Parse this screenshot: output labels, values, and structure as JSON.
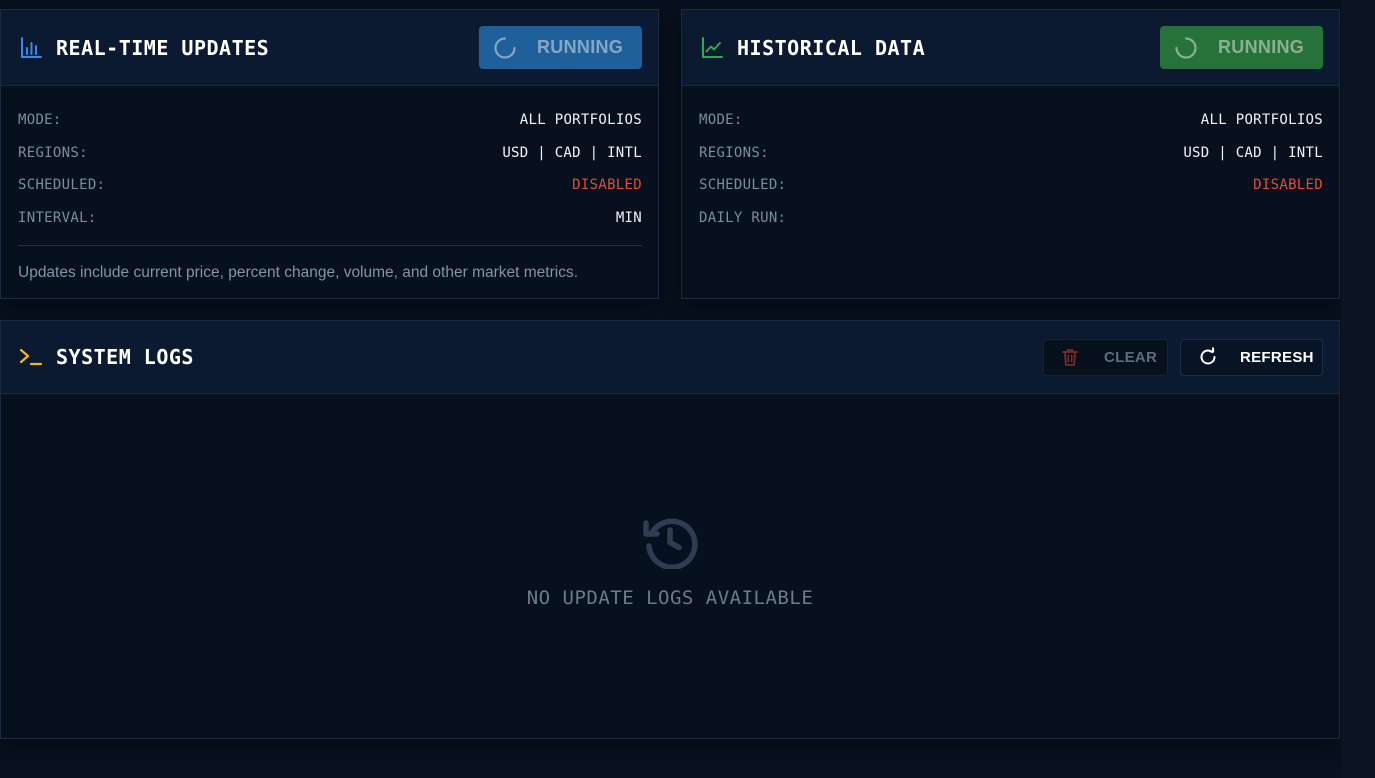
{
  "realtime": {
    "title": "REAL-TIME UPDATES",
    "status_label": "RUNNING",
    "rows": [
      {
        "label": "MODE:",
        "value": "ALL PORTFOLIOS"
      },
      {
        "label": "REGIONS:",
        "value": "USD | CAD | INTL"
      },
      {
        "label": "SCHEDULED:",
        "value": "DISABLED"
      },
      {
        "label": "INTERVAL:",
        "value": "MIN"
      }
    ],
    "note": "Updates include current price, percent change, volume, and other market metrics."
  },
  "historical": {
    "title": "HISTORICAL DATA",
    "status_label": "RUNNING",
    "rows": [
      {
        "label": "MODE:",
        "value": "ALL PORTFOLIOS"
      },
      {
        "label": "REGIONS:",
        "value": "USD | CAD | INTL"
      },
      {
        "label": "SCHEDULED:",
        "value": "DISABLED"
      },
      {
        "label": "DAILY RUN:",
        "value": ""
      }
    ]
  },
  "logs": {
    "title": "SYSTEM LOGS",
    "clear_label": "CLEAR",
    "refresh_label": "REFRESH",
    "empty_message": "NO UPDATE LOGS AVAILABLE"
  },
  "icons": {
    "realtime": "bar-chart-icon",
    "historical": "line-chart-icon",
    "logs": "terminal-icon",
    "clear": "trash-icon",
    "refresh": "refresh-icon",
    "empty": "history-icon",
    "spinner": "spinner-icon"
  },
  "colors": {
    "blue_accent": "#2f8cf0",
    "green_accent": "#2fa84f",
    "yellow_accent": "#f2b418",
    "disabled_red": "#e5483d",
    "running_blue": "#1f5f9a",
    "running_green": "#27723b"
  }
}
